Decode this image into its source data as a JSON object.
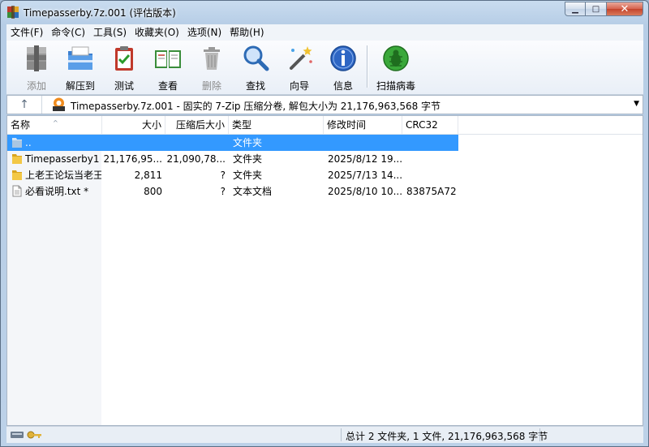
{
  "window": {
    "title": "Timepasserby.7z.001 (评估版本)",
    "minimize_glyph": "▁",
    "maximize_glyph": "□",
    "close_glyph": "✕"
  },
  "menu": [
    "文件(F)",
    "命令(C)",
    "工具(S)",
    "收藏夹(O)",
    "选项(N)",
    "帮助(H)"
  ],
  "toolbar": {
    "add": "添加",
    "extract": "解压到",
    "test": "测试",
    "view": "查看",
    "delete": "删除",
    "find": "查找",
    "wizard": "向导",
    "info": "信息",
    "virus_scan": "扫描病毒"
  },
  "address": {
    "up_glyph": "↑",
    "text": "Timepasserby.7z.001 - 固实的 7-Zip 压缩分卷, 解包大小为 21,176,963,568 字节",
    "dropdown_glyph": "▼"
  },
  "columns": {
    "name": "名称",
    "size": "大小",
    "packed": "压缩后大小",
    "type": "类型",
    "modified": "修改时间",
    "crc": "CRC32",
    "sort_glyph": "^"
  },
  "files": [
    {
      "name": "..",
      "size": "",
      "packed": "",
      "type": "文件夹",
      "modified": "",
      "crc": "",
      "icon": "parent-folder-icon"
    },
    {
      "name": "Timepasserby1",
      "size": "21,176,95...",
      "packed": "21,090,78...",
      "type": "文件夹",
      "modified": "2025/8/12 19...",
      "crc": "",
      "icon": "folder-icon"
    },
    {
      "name": "上老王论坛当老王",
      "size": "2,811",
      "packed": "?",
      "type": "文件夹",
      "modified": "2025/7/13 14...",
      "crc": "",
      "icon": "folder-icon"
    },
    {
      "name": "必看说明.txt *",
      "size": "800",
      "packed": "?",
      "type": "文本文档",
      "modified": "2025/8/10 10...",
      "crc": "83875A72",
      "icon": "text-file-icon"
    }
  ],
  "status": {
    "summary": "总计 2 文件夹, 1 文件, 21,176,963,568 字节"
  },
  "colors": {
    "selection": "#3399ff",
    "window_frame": "#b6cde6"
  }
}
